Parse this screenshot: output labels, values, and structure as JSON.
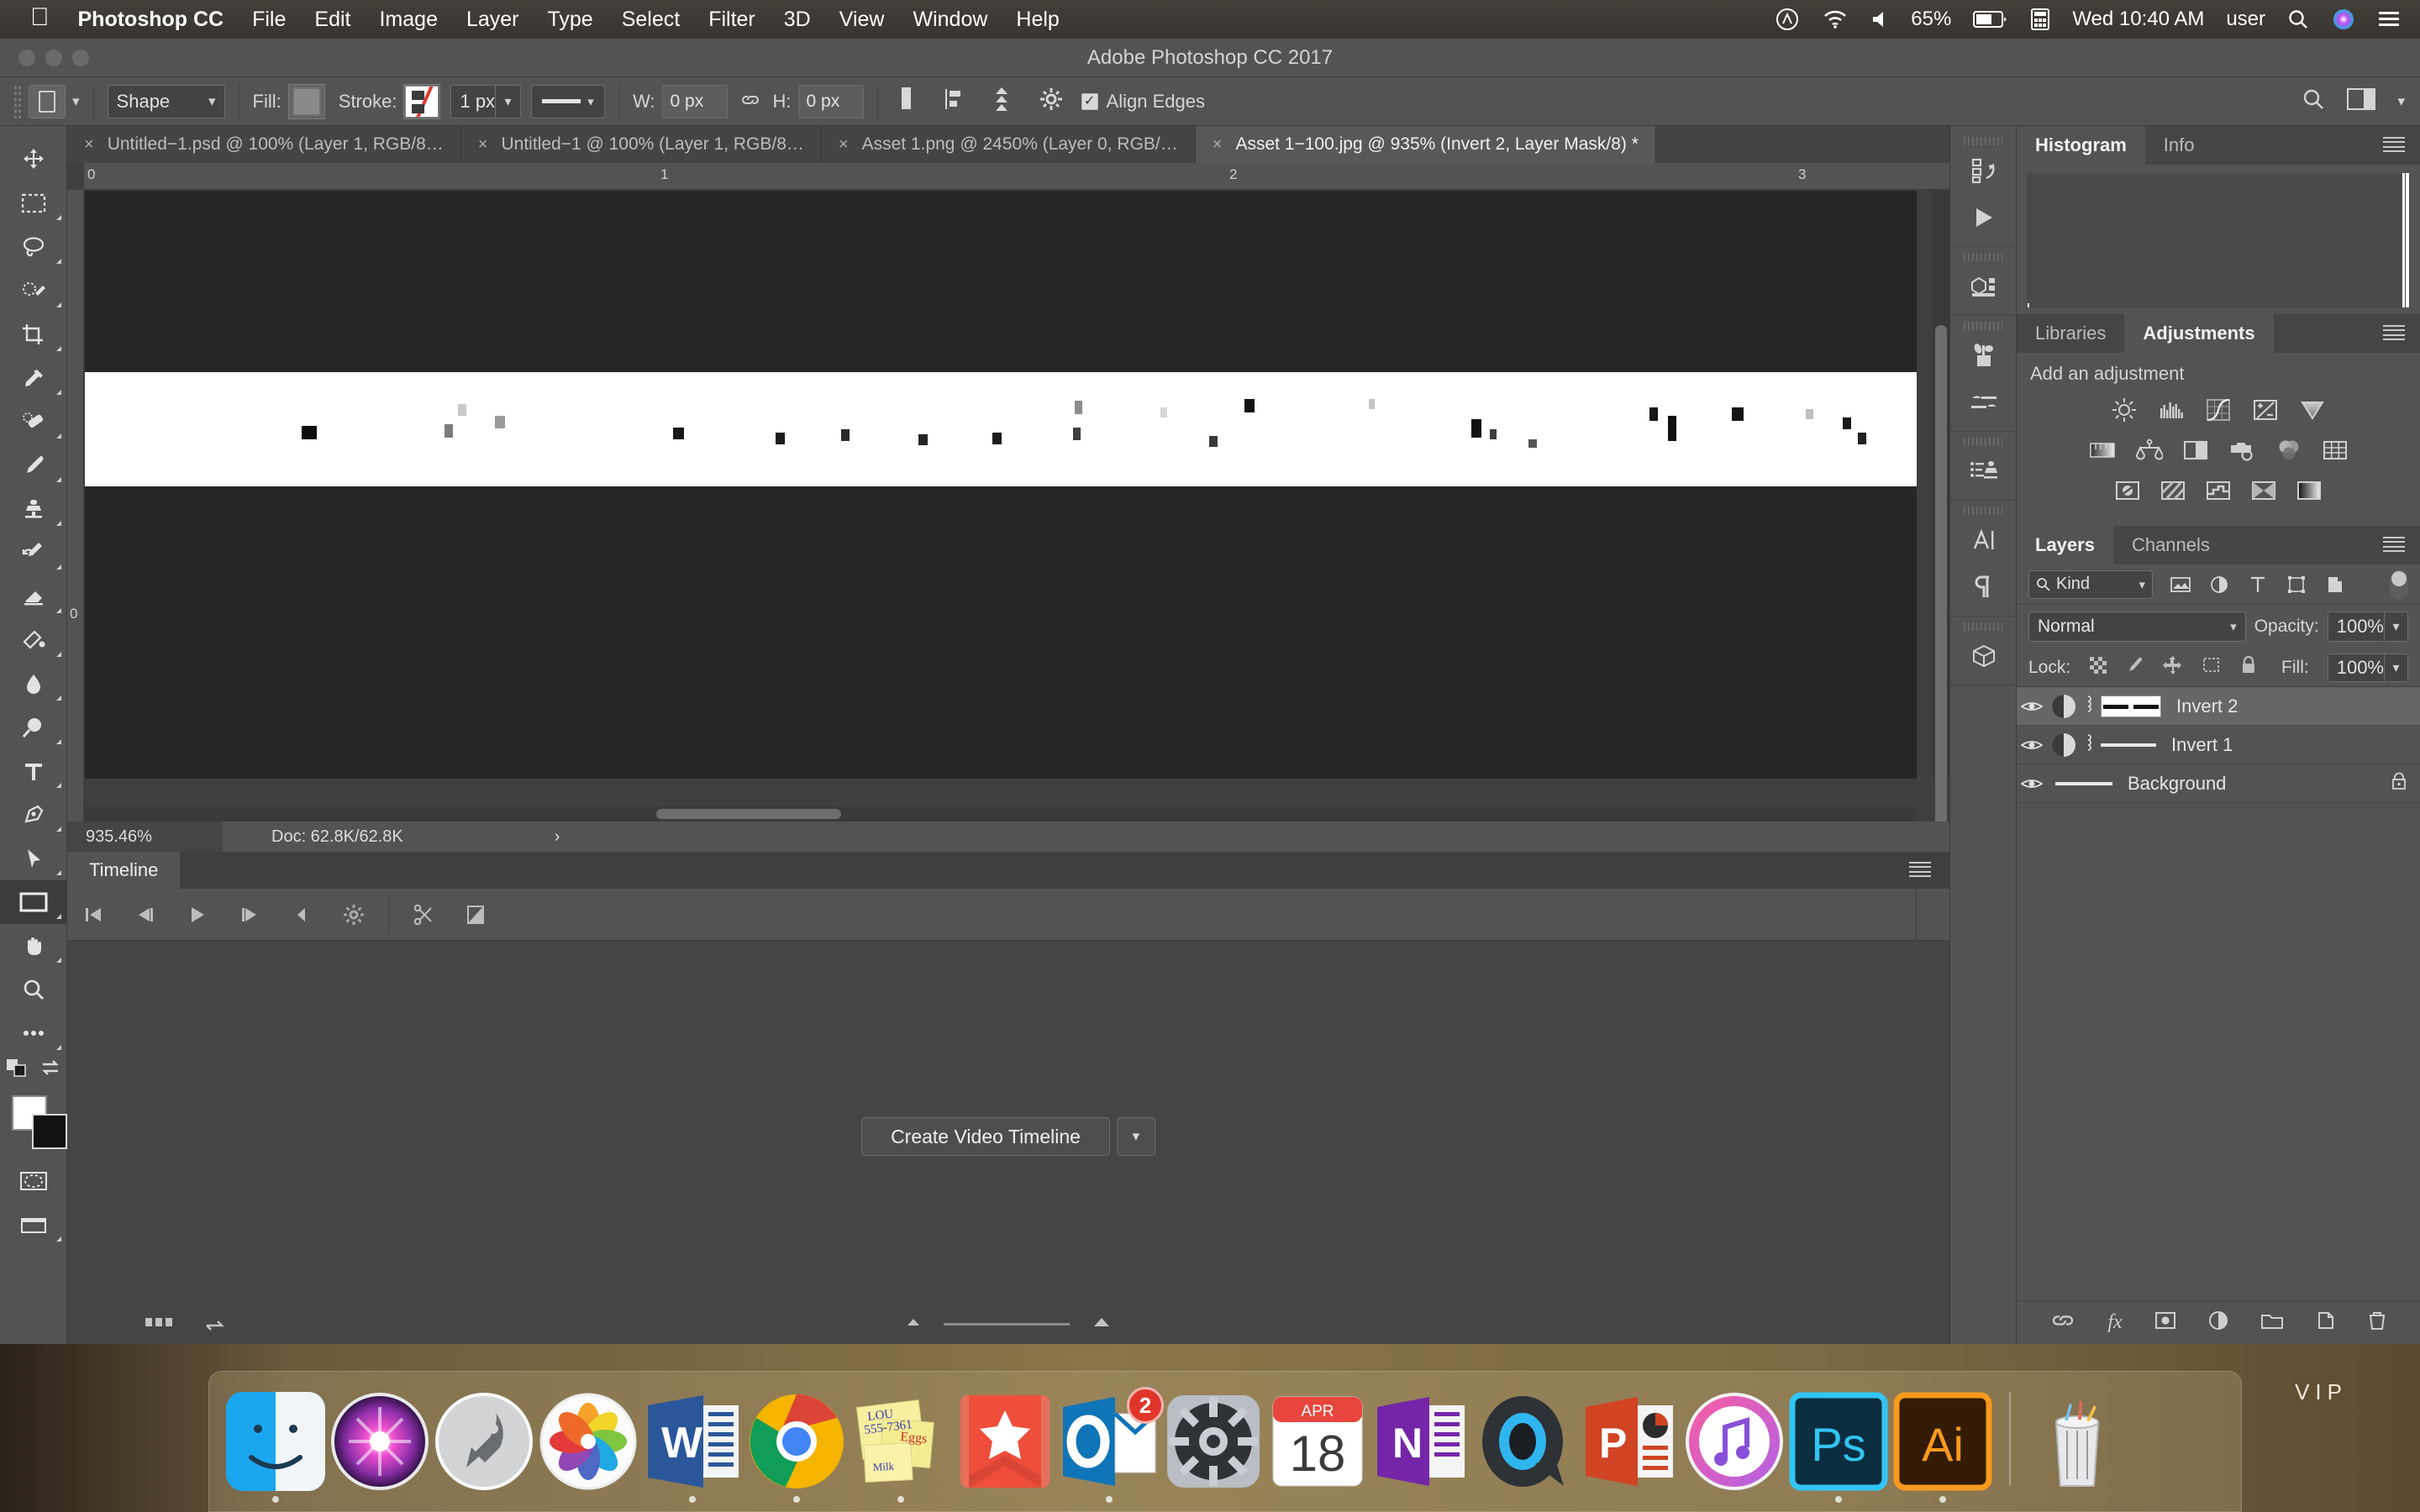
{
  "menubar": {
    "apple": "apple-logo",
    "app": "Photoshop CC",
    "items": [
      "File",
      "Edit",
      "Image",
      "Layer",
      "Type",
      "Select",
      "Filter",
      "3D",
      "View",
      "Window",
      "Help"
    ],
    "right": {
      "creative_cloud": "creative-cloud-icon",
      "wifi": "wifi-icon",
      "volume": "volume-icon",
      "battery_pct": "65%",
      "calculator": "calculator-icon",
      "clock": "Wed 10:40 AM",
      "user": "user",
      "spotlight": "search-icon",
      "siri": "siri-icon",
      "notifications": "notification-center-icon"
    }
  },
  "titlebar": {
    "title": "Adobe Photoshop CC 2017"
  },
  "options": {
    "tool_preset": "shape-tool-preset",
    "shape_mode": "Shape",
    "fill_label": "Fill:",
    "stroke_label": "Stroke:",
    "stroke_width": "1 px",
    "line_style": "line-style-solid",
    "w_label": "W:",
    "w_value": "0 px",
    "link_icon": "link-icon",
    "h_label": "H:",
    "h_value": "0 px",
    "path_align": "path-alignment-icon",
    "path_arrange": "path-arrangement-icon",
    "path_ops": "path-operations-icon",
    "gear": "gear-icon",
    "align_edges": "Align Edges",
    "align_edges_checked": "✓",
    "search": "search-icon",
    "workspace": "workspace-switcher-icon",
    "workspace_caret": "chevron-down-icon"
  },
  "tabs": [
    {
      "close": "×",
      "label": "Untitled−1.psd @ 100% (Layer 1, RGB/8…",
      "active": false
    },
    {
      "close": "×",
      "label": "Untitled−1 @ 100% (Layer 1, RGB/8…",
      "active": false
    },
    {
      "close": "×",
      "label": "Asset 1.png @ 2450% (Layer 0, RGB/…",
      "active": false
    },
    {
      "close": "×",
      "label": "Asset 1−100.jpg @ 935% (Invert 2, Layer Mask/8) *",
      "active": true
    }
  ],
  "toolbar": [
    "move-tool",
    "rectangular-marquee-tool",
    "lasso-tool",
    "quick-selection-tool",
    "crop-tool",
    "eyedropper-tool",
    "spot-healing-brush-tool",
    "brush-tool",
    "clone-stamp-tool",
    "history-brush-tool",
    "eraser-tool",
    "gradient-tool",
    "blur-tool",
    "dodge-tool",
    "type-tool",
    "pen-tool",
    "path-selection-tool",
    "rectangle-tool",
    "hand-tool",
    "zoom-tool",
    "more-tools",
    "default-colors",
    "swap-colors",
    "quick-mask-mode",
    "screen-mode"
  ],
  "toolbar_selected": "rectangle-tool",
  "canvas": {
    "ruler_h_ticks": [
      "0",
      "1",
      "2",
      "3"
    ],
    "ruler_v_ticks": [
      "0"
    ],
    "zoom": "935.46%",
    "doc_info": "Doc: 62.8K/62.8K",
    "status_arrow": "›",
    "band_color": "#ffffff",
    "backdrop_color": "#262626"
  },
  "timeline": {
    "tab": "Timeline",
    "panel_menu": "panel-menu-icon",
    "controls": [
      "go-to-first-frame",
      "select-previous-frame",
      "play",
      "select-next-frame",
      "audio-mute",
      "transitions-settings",
      "split-at-playhead",
      "transition-gradient"
    ],
    "create_button": "Create Video Timeline",
    "create_caret": "chevron-down-icon",
    "footer": [
      "filmstrip-view-icon",
      "convert-to-frame-animation-icon",
      "zoom-out-icon",
      "zoom-in-icon"
    ]
  },
  "icon_rail": [
    "history-icon",
    "actions-play-icon",
    "3d-scene-icon",
    "brush-settings-icon",
    "brush-presets-icon",
    "clone-source-icon",
    "character-icon",
    "paragraph-icon",
    "3d-panel-icon"
  ],
  "panels": {
    "histogram": {
      "tabs": [
        {
          "label": "Histogram",
          "active": true
        },
        {
          "label": "Info",
          "active": false
        }
      ],
      "menu": "panel-menu-icon"
    },
    "adjustments": {
      "tabs": [
        {
          "label": "Libraries",
          "active": false
        },
        {
          "label": "Adjustments",
          "active": true
        }
      ],
      "menu": "panel-menu-icon",
      "title": "Add an adjustment",
      "row1": [
        "brightness-contrast-icon",
        "levels-icon",
        "curves-icon",
        "exposure-icon",
        "vibrance-icon"
      ],
      "row2": [
        "hue-saturation-icon",
        "color-balance-icon",
        "black-white-icon",
        "photo-filter-icon",
        "channel-mixer-icon",
        "color-lookup-icon"
      ],
      "row3": [
        "invert-icon",
        "posterize-icon",
        "threshold-icon",
        "gradient-map-icon",
        "selective-color-icon"
      ]
    },
    "layers": {
      "tabs": [
        {
          "label": "Layers",
          "active": true
        },
        {
          "label": "Channels",
          "active": false
        }
      ],
      "menu": "panel-menu-icon",
      "filter_kind": "Kind",
      "filter_icons": [
        "filter-pixel-icon",
        "filter-adjustment-icon",
        "filter-type-icon",
        "filter-shape-icon",
        "filter-smart-object-icon"
      ],
      "filter_toggle": "filter-enable-toggle",
      "blend_mode": "Normal",
      "opacity_label": "Opacity:",
      "opacity_value": "100%",
      "lock_label": "Lock:",
      "lock_icons": [
        "lock-transparent-pixels-icon",
        "lock-image-pixels-icon",
        "lock-position-icon",
        "lock-artboard-icon",
        "lock-all-icon"
      ],
      "fill_label": "Fill:",
      "fill_value": "100%",
      "rows": [
        {
          "name": "Invert 2",
          "visible": true,
          "selected": true,
          "kind": "adjustment-with-mask",
          "locked": false
        },
        {
          "name": "Invert 1",
          "visible": true,
          "selected": false,
          "kind": "adjustment-with-mask",
          "locked": false
        },
        {
          "name": "Background",
          "visible": true,
          "selected": false,
          "kind": "image",
          "locked": true
        }
      ],
      "footer_icons": [
        "link-layers-icon",
        "layer-style-fx-icon",
        "add-layer-mask-icon",
        "new-adjustment-layer-icon",
        "new-group-icon",
        "new-layer-icon",
        "delete-layer-icon"
      ]
    }
  },
  "dock": {
    "items": [
      {
        "name": "finder-icon",
        "badge": null
      },
      {
        "name": "siri-icon",
        "badge": null
      },
      {
        "name": "launchpad-icon",
        "badge": null
      },
      {
        "name": "photos-icon",
        "badge": null
      },
      {
        "name": "microsoft-word-icon",
        "badge": null
      },
      {
        "name": "google-chrome-icon",
        "badge": null
      },
      {
        "name": "stickies-icon",
        "badge": null
      },
      {
        "name": "wunderlist-icon",
        "badge": null
      },
      {
        "name": "microsoft-outlook-icon",
        "badge": "2"
      },
      {
        "name": "system-preferences-icon",
        "badge": null
      },
      {
        "name": "calendar-icon",
        "badge": null
      },
      {
        "name": "microsoft-onenote-icon",
        "badge": null
      },
      {
        "name": "quicktime-icon",
        "badge": null
      },
      {
        "name": "microsoft-powerpoint-icon",
        "badge": null
      },
      {
        "name": "itunes-icon",
        "badge": null
      },
      {
        "name": "adobe-photoshop-icon",
        "badge": null
      },
      {
        "name": "adobe-illustrator-icon",
        "badge": null
      },
      {
        "name": "trash-icon",
        "badge": null
      }
    ],
    "calendar_month": "APR",
    "calendar_day": "18",
    "stickies_lines": [
      "LOU",
      "555-7361",
      "Eggs",
      "Milk"
    ],
    "wallpaper_text": "VIP"
  }
}
